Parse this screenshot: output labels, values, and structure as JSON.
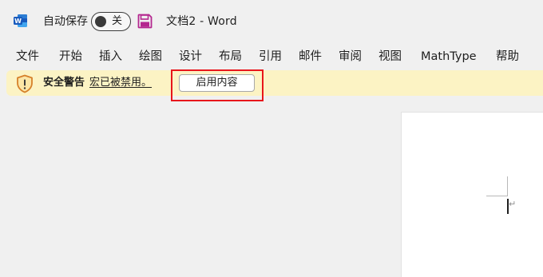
{
  "titlebar": {
    "app_icon": "word-logo-icon",
    "autosave_label": "自动保存",
    "autosave_state": "关",
    "save_icon": "floppy-disk-icon",
    "doc_title": "文档2  -  Word"
  },
  "menu": {
    "items": [
      {
        "label": "文件"
      },
      {
        "label": "开始"
      },
      {
        "label": "插入"
      },
      {
        "label": "绘图"
      },
      {
        "label": "设计"
      },
      {
        "label": "布局"
      },
      {
        "label": "引用"
      },
      {
        "label": "邮件"
      },
      {
        "label": "审阅"
      },
      {
        "label": "视图"
      },
      {
        "label": "MathType"
      },
      {
        "label": "帮助"
      }
    ]
  },
  "security_bar": {
    "icon": "shield-warning-icon",
    "title": "安全警告",
    "message": "宏已被禁用。",
    "button_label": "启用内容"
  },
  "document": {
    "paragraph_mark": "↵"
  },
  "colors": {
    "word_blue": "#185abd",
    "save_purple": "#b4278f",
    "warning_bg": "#fcf3c4",
    "shield_orange": "#d6802a",
    "highlight_red": "#e8161b"
  }
}
